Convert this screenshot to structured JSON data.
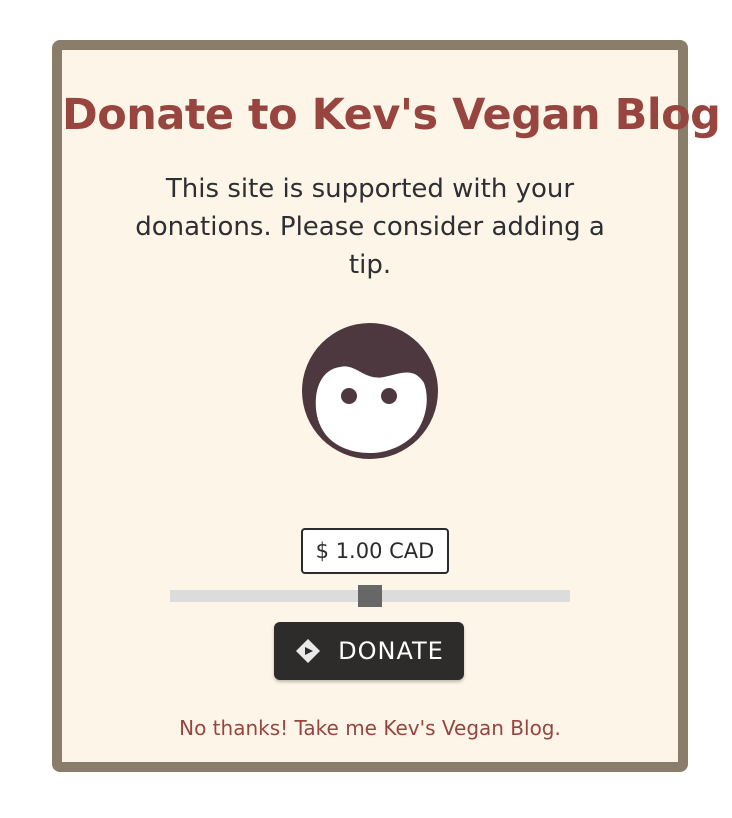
{
  "modal": {
    "title": "Donate to Kev's Vegan Blog",
    "description": "This site is supported with your\ndonations. Please consider adding a\ntip.",
    "avatar_icon": "face-icon",
    "amount_display": "$ 1.00 CAD",
    "slider": {
      "value_fraction": 0.5
    },
    "donate_button": {
      "label": "DONATE",
      "icon": "kofi-diamond-icon"
    },
    "dismiss_link": "No thanks! Take me Kev's Vegan Blog."
  },
  "colors": {
    "border": "#8a7d69",
    "background": "#fdf6e8",
    "accent": "#97453e",
    "face": "#4e3840",
    "button": "#2d2c2a",
    "slider_track": "#dcdcdc",
    "slider_thumb": "#676767"
  }
}
